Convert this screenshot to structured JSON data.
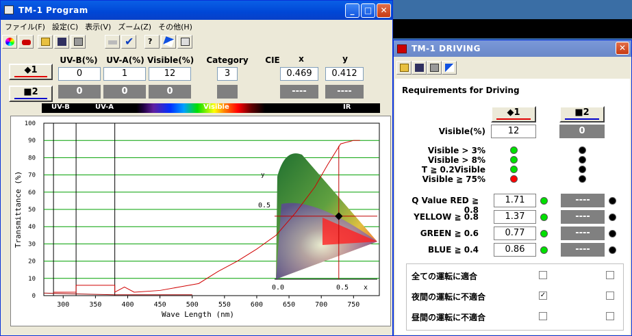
{
  "main": {
    "title": "TM-1 Program",
    "menus": [
      "ファイル(F)",
      "設定(C)",
      "表示(V)",
      "ズーム(Z)",
      "その他(H)"
    ],
    "headers": {
      "uvb": "UV-B(%)",
      "uva": "UV-A(%)",
      "visible": "Visible(%)",
      "category": "Category",
      "cie": "CIE",
      "x": "x",
      "y": "y"
    },
    "sample1": {
      "label": "◆1",
      "uvb": "0",
      "uva": "1",
      "visible": "12",
      "category": "3",
      "x": "0.469",
      "y": "0.412",
      "color": "#e00000"
    },
    "sample2": {
      "label": "■2",
      "uvb": "0",
      "uva": "0",
      "visible": "0",
      "category": "",
      "x": "----",
      "y": "----",
      "color": "#0000cc"
    },
    "spectrum_bar": {
      "uvb": "UV-B",
      "uva": "UV-A",
      "visible": "Visible",
      "ir": "IR"
    }
  },
  "chart_data": {
    "type": "line",
    "xlabel": "Wave Length (nm)",
    "ylabel": "Transmittance (%)",
    "xlim": [
      270,
      790
    ],
    "ylim": [
      0,
      100
    ],
    "xticks": [
      300,
      350,
      400,
      450,
      500,
      550,
      600,
      650,
      700,
      750
    ],
    "yticks": [
      0,
      10,
      20,
      30,
      40,
      50,
      60,
      70,
      80,
      90,
      100
    ],
    "vlines": [
      285,
      320,
      380
    ],
    "series": [
      {
        "values": [
          [
            285,
            2
          ],
          [
            320,
            2
          ],
          [
            320,
            6
          ],
          [
            380,
            6
          ],
          [
            380,
            2
          ],
          [
            395,
            5
          ],
          [
            410,
            2
          ],
          [
            450,
            3
          ],
          [
            480,
            5
          ],
          [
            510,
            7
          ],
          [
            540,
            14
          ],
          [
            570,
            20
          ],
          [
            600,
            27
          ],
          [
            630,
            35
          ],
          [
            660,
            48
          ],
          [
            690,
            63
          ],
          [
            710,
            76
          ],
          [
            730,
            88
          ],
          [
            750,
            90
          ],
          [
            760,
            90
          ]
        ]
      },
      {
        "values": [
          [
            270,
            1.5
          ],
          [
            320,
            1
          ],
          [
            380,
            0.5
          ],
          [
            400,
            0.5
          ],
          [
            450,
            0.5
          ],
          [
            500,
            0.5
          ]
        ]
      }
    ],
    "inset": {
      "xticks": [
        "0.0",
        "0.5"
      ],
      "yticks": [
        "0.5"
      ],
      "xlabel": "x",
      "ylabel": "y",
      "point": [
        0.469,
        0.412
      ]
    }
  },
  "driving": {
    "title": "TM-1 DRIVING",
    "heading": "Requirements for Driving",
    "btn1": "◆1",
    "btn2": "■2",
    "visible_label": "Visible(%)",
    "visible1": "12",
    "visible2": "0",
    "checks": [
      {
        "label": "Visible > 3%",
        "s1": "#00e000",
        "s2": "#000000"
      },
      {
        "label": "Visible > 8%",
        "s1": "#00e000",
        "s2": "#000000"
      },
      {
        "label": "T ≧ 0.2Visible",
        "s1": "#00e000",
        "s2": "#000000"
      },
      {
        "label": "Visible ≧ 75%",
        "s1": "#ff0000",
        "s2": "#000000"
      }
    ],
    "qvalues": [
      {
        "label": "Q Value RED ≧ 0.8",
        "v1": "1.71",
        "v2": "----"
      },
      {
        "label": "YELLOW ≧ 0.8",
        "v1": "1.37",
        "v2": "----"
      },
      {
        "label": "GREEN ≧ 0.6",
        "v1": "0.77",
        "v2": "----"
      },
      {
        "label": "BLUE ≧ 0.4",
        "v1": "0.86",
        "v2": "----"
      }
    ],
    "results": [
      {
        "label": "全ての運転に適合",
        "c1": "",
        "c2": ""
      },
      {
        "label": "夜間の運転に不適合",
        "c1": "✓",
        "c2": ""
      },
      {
        "label": "昼間の運転に不適合",
        "c1": "",
        "c2": ""
      }
    ]
  }
}
